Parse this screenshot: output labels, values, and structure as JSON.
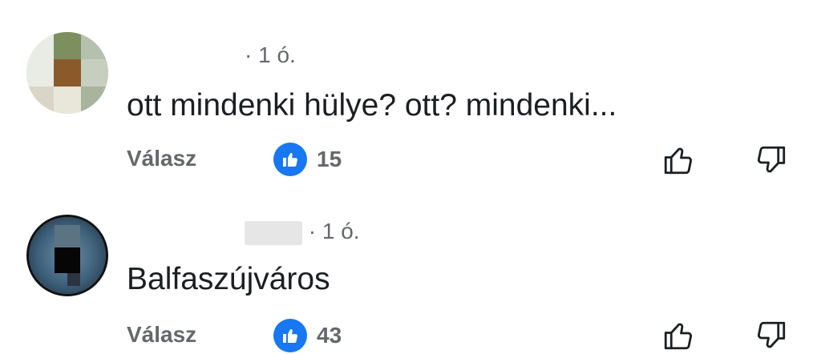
{
  "comments": [
    {
      "time": "· 1 ó.",
      "text": "ott mindenki hülye? ott? mindenki...",
      "reply_label": "Válasz",
      "like_count": "15"
    },
    {
      "time": "· 1 ó.",
      "text": "Balfaszújváros",
      "reply_label": "Válasz",
      "like_count": "43"
    }
  ],
  "colors": {
    "like_badge": "#1877f2",
    "secondary_text": "#65676b",
    "primary_text": "#1c1e21"
  },
  "icons": {
    "like_badge": "thumbs-up-icon",
    "upvote": "thumbs-up-outline-icon",
    "downvote": "thumbs-down-outline-icon"
  }
}
